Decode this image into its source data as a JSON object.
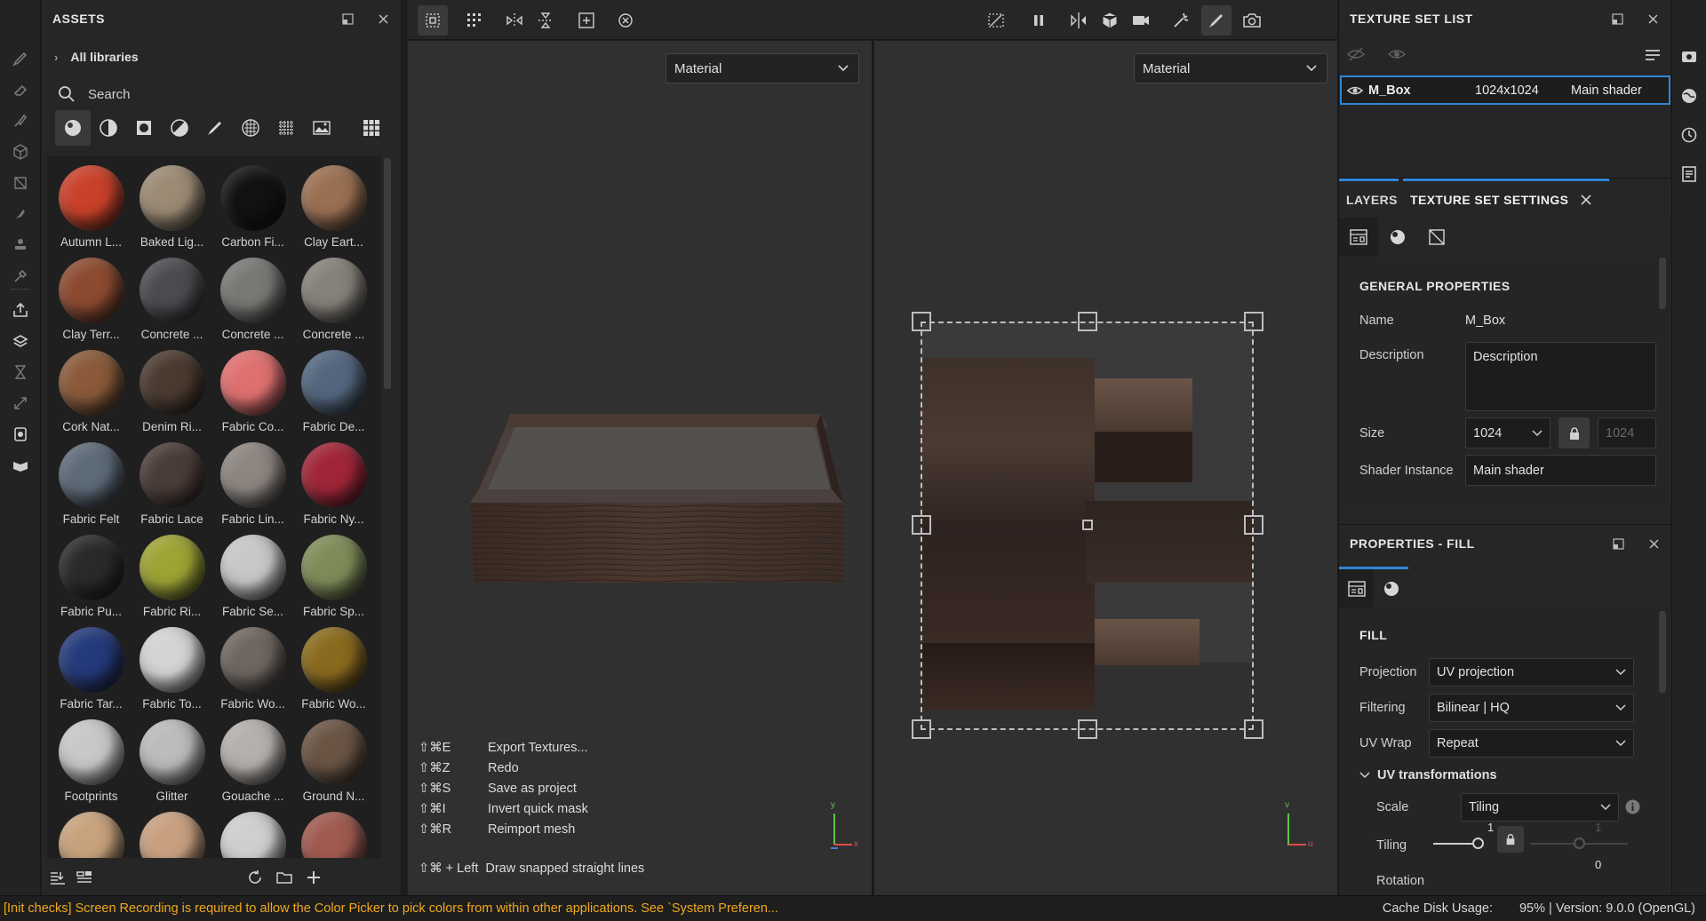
{
  "assets": {
    "title": "ASSETS",
    "libraries_label": "All libraries",
    "search_placeholder": "Search",
    "materials": [
      {
        "name": "Autumn L...",
        "color": "#c9412a"
      },
      {
        "name": "Baked Lig...",
        "color": "#9b8a74"
      },
      {
        "name": "Carbon Fi...",
        "color": "#121212"
      },
      {
        "name": "Clay Eart...",
        "color": "#9a7052"
      },
      {
        "name": "Clay Terr...",
        "color": "#8c4a30"
      },
      {
        "name": "Concrete ...",
        "color": "#4b4b50"
      },
      {
        "name": "Concrete ...",
        "color": "#7a7875"
      },
      {
        "name": "Concrete ...",
        "color": "#86827a"
      },
      {
        "name": "Cork Nat...",
        "color": "#8a5a3a"
      },
      {
        "name": "Denim Ri...",
        "color": "#4a3a30"
      },
      {
        "name": "Fabric Co...",
        "color": "#e07070"
      },
      {
        "name": "Fabric De...",
        "color": "#53667e"
      },
      {
        "name": "Fabric Felt",
        "color": "#5d6a78"
      },
      {
        "name": "Fabric Lace",
        "color": "#4a3c38"
      },
      {
        "name": "Fabric Lin...",
        "color": "#8c8580"
      },
      {
        "name": "Fabric Ny...",
        "color": "#a02538"
      },
      {
        "name": "Fabric Pu...",
        "color": "#2a2a2a"
      },
      {
        "name": "Fabric Ri...",
        "color": "#9ea334"
      },
      {
        "name": "Fabric Se...",
        "color": "#c8c8c8"
      },
      {
        "name": "Fabric Sp...",
        "color": "#7f8c58"
      },
      {
        "name": "Fabric Tar...",
        "color": "#243a7a"
      },
      {
        "name": "Fabric To...",
        "color": "#d4d4d4"
      },
      {
        "name": "Fabric Wo...",
        "color": "#6e6660"
      },
      {
        "name": "Fabric Wo...",
        "color": "#8a6a1e"
      },
      {
        "name": "Footprints",
        "color": "#c8c8c8"
      },
      {
        "name": "Glitter",
        "color": "#bcbcbc"
      },
      {
        "name": "Gouache ...",
        "color": "#b6b0ac"
      },
      {
        "name": "Ground N...",
        "color": "#6a5444"
      },
      {
        "name": "",
        "color": "#c8a27c"
      },
      {
        "name": "",
        "color": "#c8a080"
      },
      {
        "name": "",
        "color": "#cfcfcf"
      },
      {
        "name": "",
        "color": "#a05a50"
      }
    ]
  },
  "viewports": {
    "left_select": "Material",
    "right_select": "Material"
  },
  "hotkeys": [
    {
      "key": "⇧⌘E",
      "action": "Export Textures..."
    },
    {
      "key": "⇧⌘Z",
      "action": "Redo"
    },
    {
      "key": "⇧⌘S",
      "action": "Save as project"
    },
    {
      "key": "⇧⌘I",
      "action": "Invert quick mask"
    },
    {
      "key": "⇧⌘R",
      "action": "Reimport mesh"
    }
  ],
  "drag_hint": {
    "key": "⇧⌘ + Left",
    "action": "Draw snapped straight lines"
  },
  "axes": {
    "y": "y",
    "x": "x",
    "v": "v",
    "u": "u"
  },
  "texture_set_list": {
    "title": "TEXTURE SET LIST",
    "row": {
      "name": "M_Box",
      "resolution": "1024x1024",
      "shader": "Main shader"
    }
  },
  "tabs": {
    "layers": "LAYERS",
    "texture_set_settings": "TEXTURE SET SETTINGS"
  },
  "general_properties": {
    "title": "GENERAL PROPERTIES",
    "name_label": "Name",
    "name_value": "M_Box",
    "description_label": "Description",
    "description_value": "Description",
    "size_label": "Size",
    "size_value": "1024",
    "size_locked_value": "1024",
    "shader_label": "Shader Instance",
    "shader_value": "Main shader"
  },
  "properties_fill": {
    "title": "PROPERTIES - FILL",
    "section": "FILL",
    "projection_label": "Projection",
    "projection_value": "UV projection",
    "filtering_label": "Filtering",
    "filtering_value": "Bilinear | HQ",
    "uvwrap_label": "UV Wrap",
    "uvwrap_value": "Repeat",
    "uv_transform_label": "UV transformations",
    "scale_label": "Scale",
    "scale_value": "Tiling",
    "tiling_label": "Tiling",
    "tiling_u": "1",
    "tiling_v": "1",
    "rotation_label": "Rotation",
    "rotation_value": "0"
  },
  "status": {
    "message": "[Init checks] Screen Recording is required to allow the Color Picker to pick colors from within other applications. See `System Preferen...",
    "cache": "Cache Disk Usage:",
    "version": "95% | Version: 9.0.0 (OpenGL)"
  },
  "colors": {
    "accent": "#2f86d6",
    "warning": "#f0a81c",
    "badge": "#f08a1c"
  }
}
